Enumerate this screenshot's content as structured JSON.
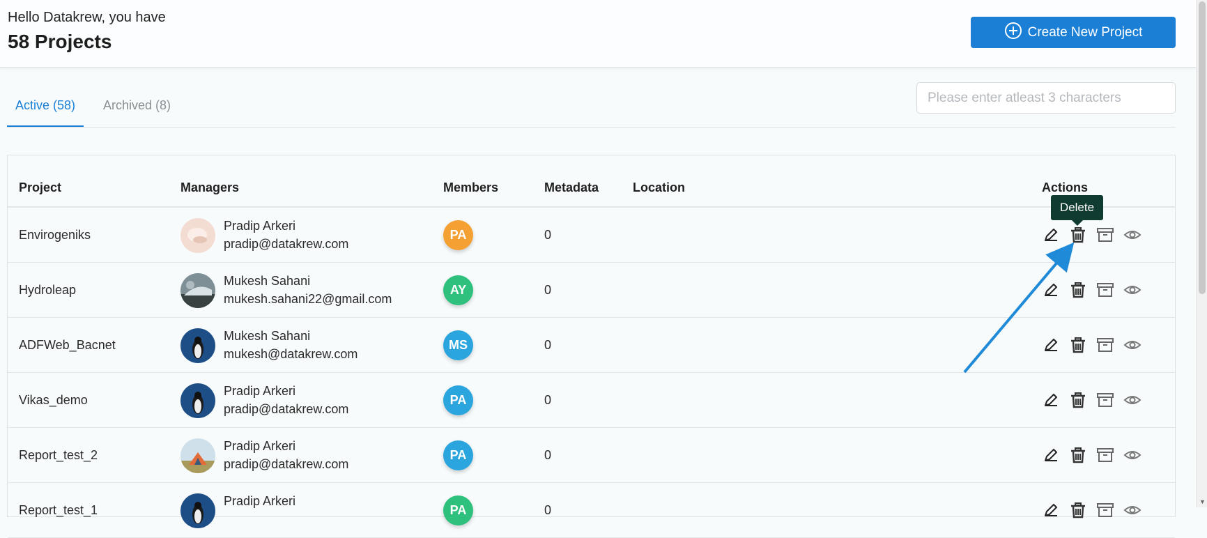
{
  "header": {
    "greeting": "Hello Datakrew, you have",
    "project_count": "58 Projects",
    "create_button": "Create New Project"
  },
  "tabs": [
    {
      "label": "Active (58)",
      "active": true
    },
    {
      "label": "Archived (8)",
      "active": false
    }
  ],
  "search": {
    "placeholder": "Please enter atleast 3 characters",
    "value": ""
  },
  "table": {
    "columns": [
      "Project",
      "Managers",
      "Members",
      "Metadata",
      "Location",
      "Actions"
    ],
    "rows": [
      {
        "project": "Envirogeniks",
        "manager_name": "Pradip Arkeri",
        "manager_email": "pradip@datakrew.com",
        "member": "PA",
        "member_color": "#f5a033",
        "metadata": "0",
        "location": ""
      },
      {
        "project": "Hydroleap",
        "manager_name": "Mukesh Sahani",
        "manager_email": "mukesh.sahani22@gmail.com",
        "member": "AY",
        "member_color": "#2ec07d",
        "metadata": "0",
        "location": ""
      },
      {
        "project": "ADFWeb_Bacnet",
        "manager_name": "Mukesh Sahani",
        "manager_email": "mukesh@datakrew.com",
        "member": "MS",
        "member_color": "#2aa5de",
        "metadata": "0",
        "location": ""
      },
      {
        "project": "Vikas_demo",
        "manager_name": "Pradip Arkeri",
        "manager_email": "pradip@datakrew.com",
        "member": "PA",
        "member_color": "#2aa5de",
        "metadata": "0",
        "location": ""
      },
      {
        "project": "Report_test_2",
        "manager_name": "Pradip Arkeri",
        "manager_email": "pradip@datakrew.com",
        "member": "PA",
        "member_color": "#2aa5de",
        "metadata": "0",
        "location": ""
      },
      {
        "project": "Report_test_1",
        "manager_name": "Pradip Arkeri",
        "manager_email": "",
        "member": "PA",
        "member_color": "#2ec07d",
        "metadata": "0",
        "location": ""
      }
    ]
  },
  "tooltip": {
    "text": "Delete"
  },
  "icons": {
    "create": "plus-circle-icon",
    "edit": "pencil-icon",
    "delete": "trash-icon",
    "archive": "archive-box-icon",
    "view": "eye-icon"
  },
  "colors": {
    "accent": "#1b7fd6",
    "tooltip_bg": "#0f3b30",
    "annotation_arrow": "#1f8ad8"
  }
}
